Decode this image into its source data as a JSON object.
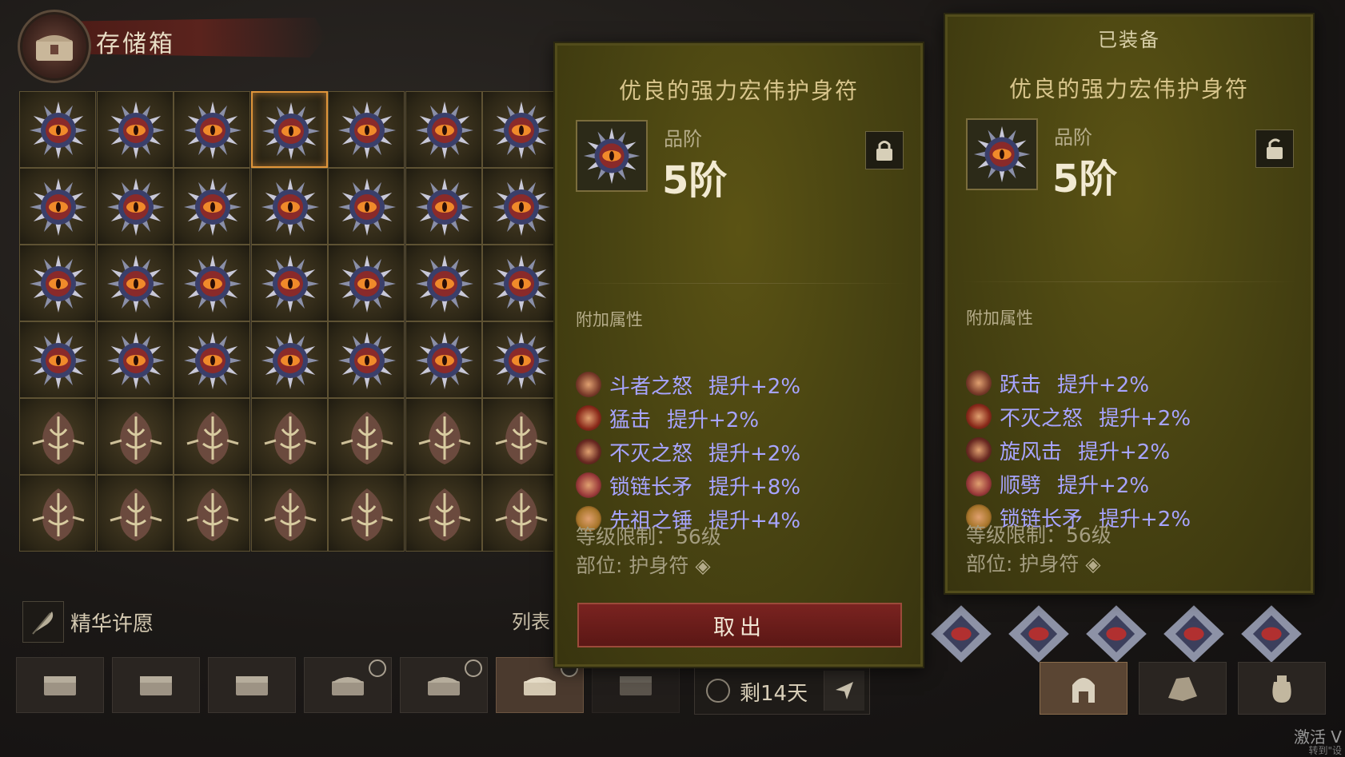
{
  "header": {
    "title": "存储箱"
  },
  "grid": {
    "rows": 6,
    "cols": 7,
    "selected_index": 3,
    "amulet_rows": 4
  },
  "bottom": {
    "essence_label": "精华许愿",
    "list_label": "列表"
  },
  "timer": {
    "text": "剩14天"
  },
  "compare_panel": {
    "item_name": "优良的强力宏伟护身符",
    "grade_label": "品阶",
    "grade_value": "5阶",
    "attr_title": "附加属性",
    "affixes": [
      {
        "skill": "斗者之怒",
        "bonus": "提升+2%"
      },
      {
        "skill": "猛击",
        "bonus": "提升+2%"
      },
      {
        "skill": "不灭之怒",
        "bonus": "提升+2%"
      },
      {
        "skill": "锁链长矛",
        "bonus": "提升+8%"
      },
      {
        "skill": "先祖之锤",
        "bonus": "提升+4%"
      }
    ],
    "level_req": "等级限制：56级",
    "slot": "部位: 护身符",
    "take_button": "取出"
  },
  "equipped_panel": {
    "header": "已装备",
    "item_name": "优良的强力宏伟护身符",
    "grade_label": "品阶",
    "grade_value": "5阶",
    "attr_title": "附加属性",
    "affixes": [
      {
        "skill": "跃击",
        "bonus": "提升+2%"
      },
      {
        "skill": "不灭之怒",
        "bonus": "提升+2%"
      },
      {
        "skill": "旋风击",
        "bonus": "提升+2%"
      },
      {
        "skill": "顺劈",
        "bonus": "提升+2%"
      },
      {
        "skill": "锁链长矛",
        "bonus": "提升+2%"
      }
    ],
    "level_req": "等级限制：56级",
    "slot": "部位: 护身符"
  },
  "colors": {
    "panel_bg": "#4a4512",
    "affix_text": "#a7a4ff",
    "take_button": "#7a2320",
    "selected_border": "#e0953a"
  },
  "watermark": {
    "line1": "激活 V",
    "line2": "转到\"设"
  }
}
